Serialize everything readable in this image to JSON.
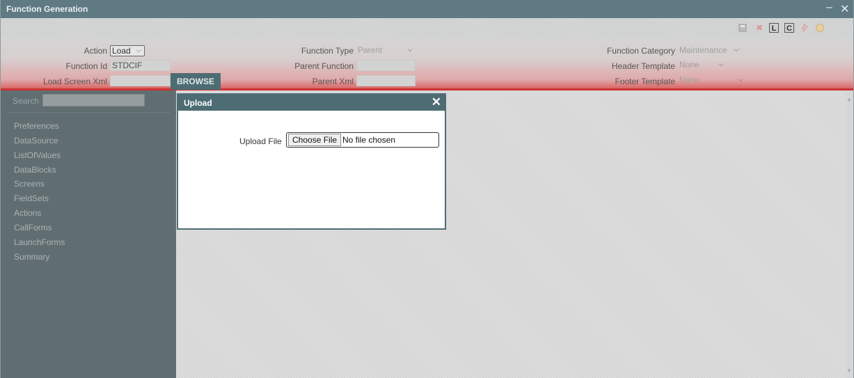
{
  "window": {
    "title": "Function Generation",
    "minimize_glyph": "–",
    "close_glyph": "✕"
  },
  "toolbar": {
    "icons": [
      "save-icon",
      "delete-icon",
      "L",
      "C",
      "lightning-icon",
      "help-icon"
    ]
  },
  "header": {
    "action": {
      "label": "Action",
      "value": "Load"
    },
    "function_id": {
      "label": "Function Id",
      "value": "STDCIF"
    },
    "load_screen_xml": {
      "label": "Load Screen Xml",
      "value": ""
    },
    "browse_label": "BROWSE",
    "function_type": {
      "label": "Function Type",
      "value": "Parent"
    },
    "parent_function": {
      "label": "Parent Function",
      "value": ""
    },
    "parent_xml": {
      "label": "Parent Xml",
      "value": ""
    },
    "function_category": {
      "label": "Function Category",
      "value": "Maintenance"
    },
    "header_template": {
      "label": "Header Template",
      "value": "None"
    },
    "footer_template": {
      "label": "Footer Template",
      "value": "None"
    }
  },
  "sidebar": {
    "search_label": "Search",
    "items": [
      {
        "label": "Preferences"
      },
      {
        "label": "DataSource"
      },
      {
        "label": "ListOfValues"
      },
      {
        "label": "DataBlocks"
      },
      {
        "label": "Screens"
      },
      {
        "label": "FieldSets"
      },
      {
        "label": "Actions"
      },
      {
        "label": "CallForms"
      },
      {
        "label": "LaunchForms"
      },
      {
        "label": "Summary"
      }
    ]
  },
  "dialog": {
    "title": "Upload",
    "close_glyph": "✕",
    "upload_label": "Upload File",
    "choose_button": "Choose File",
    "file_status": "No file chosen"
  },
  "colors": {
    "titlebar": "#5f7a82",
    "accent_red": "#cc3333",
    "sidebar": "#616e71",
    "dialog_header": "#4e6c74"
  }
}
